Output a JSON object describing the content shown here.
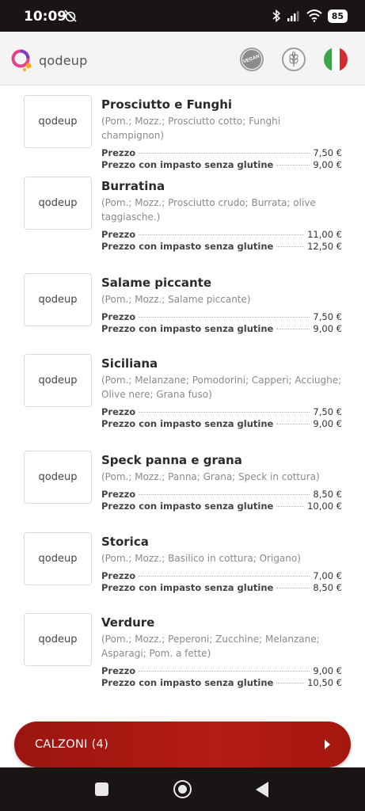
{
  "status_bar": {
    "time": "10:09",
    "battery": "85"
  },
  "app": {
    "logo_text": "qodeup",
    "vegan_badge": "VEGAN"
  },
  "items": [
    {
      "name": "Prosciutto e Funghi",
      "description": "(Pom.; Mozz.; Prosciutto cotto; Funghi champignon)",
      "price_label": "Prezzo",
      "price": "7,50 €",
      "gf_label": "Prezzo con impasto senza glutine",
      "gf_price": "9,00 €",
      "thumb": "qodeup"
    },
    {
      "name": "Burratina",
      "description": "(Pom.; Mozz.; Prosciutto crudo; Burrata; olive taggiasche.)",
      "price_label": "Prezzo",
      "price": "11,00 €",
      "gf_label": "Prezzo con impasto senza glutine",
      "gf_price": "12,50 €",
      "thumb": "qodeup"
    },
    {
      "name": "Salame piccante",
      "description": "(Pom.; Mozz.; Salame piccante)",
      "price_label": "Prezzo",
      "price": "7,50 €",
      "gf_label": "Prezzo con impasto senza glutine",
      "gf_price": "9,00 €",
      "thumb": "qodeup"
    },
    {
      "name": "Siciliana",
      "description": "(Pom.; Melanzane; Pomodorini; Capperi; Acciughe; Olive nere; Grana fuso)",
      "price_label": "Prezzo",
      "price": "7,50 €",
      "gf_label": "Prezzo con impasto senza glutine",
      "gf_price": "9,00 €",
      "thumb": "qodeup"
    },
    {
      "name": "Speck panna e grana",
      "description": "(Pom.; Mozz.; Panna; Grana; Speck in cottura)",
      "price_label": "Prezzo",
      "price": "8,50 €",
      "gf_label": "Prezzo con impasto senza glutine",
      "gf_price": "10,00 €",
      "thumb": "qodeup"
    },
    {
      "name": "Storica",
      "description": "(Pom.; Mozz.; Basilico in cottura; Origano)",
      "price_label": "Prezzo",
      "price": "7,00 €",
      "gf_label": "Prezzo con impasto senza glutine",
      "gf_price": "8,50 €",
      "thumb": "qodeup"
    },
    {
      "name": "Verdure",
      "description": "(Pom.; Mozz.; Peperoni; Zucchine; Melanzane; Asparagi; Pom. a fette)",
      "price_label": "Prezzo",
      "price": "9,00 €",
      "gf_label": "Prezzo con impasto senza glutine",
      "gf_price": "10,50 €",
      "thumb": "qodeup"
    }
  ],
  "category_button": {
    "label": "CALZONI  (4)"
  },
  "colors": {
    "accent_red": "#b41c14",
    "flag_green": "#3aa54a",
    "flag_red": "#d52b2e"
  },
  "icons": [
    "wifi-icon",
    "bluetooth-icon",
    "signal-icon",
    "vegan-icon",
    "gluten-free-icon",
    "italian-flag-icon"
  ]
}
